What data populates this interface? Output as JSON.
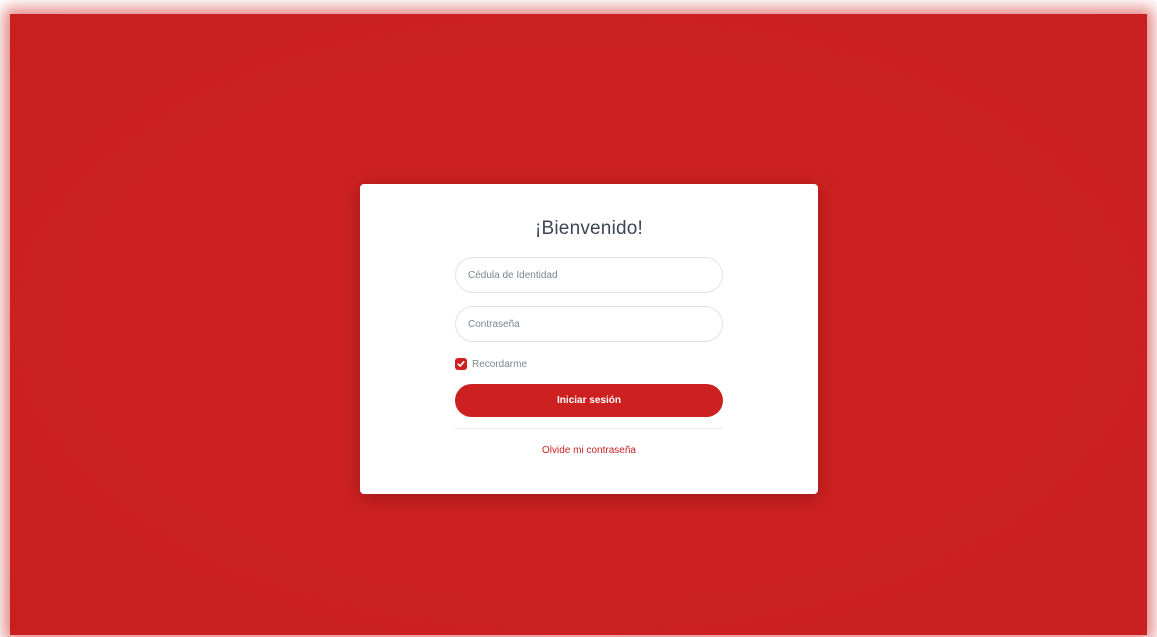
{
  "login": {
    "title": "¡Bienvenido!",
    "cedula_placeholder": "Cédula de Identidad",
    "cedula_value": "",
    "password_placeholder": "Contraseña",
    "password_value": "",
    "remember_label": "Recordarme",
    "remember_checked": true,
    "submit_label": "Iniciar sesión",
    "forgot_label": "Olvide mi contraseña"
  },
  "icons": {
    "checkbox": "checkmark-icon"
  },
  "colors": {
    "background": "#cd2121",
    "accent": "#cd2121",
    "card": "#ffffff",
    "title_text": "#3d4654",
    "muted_text": "#7d8691"
  }
}
